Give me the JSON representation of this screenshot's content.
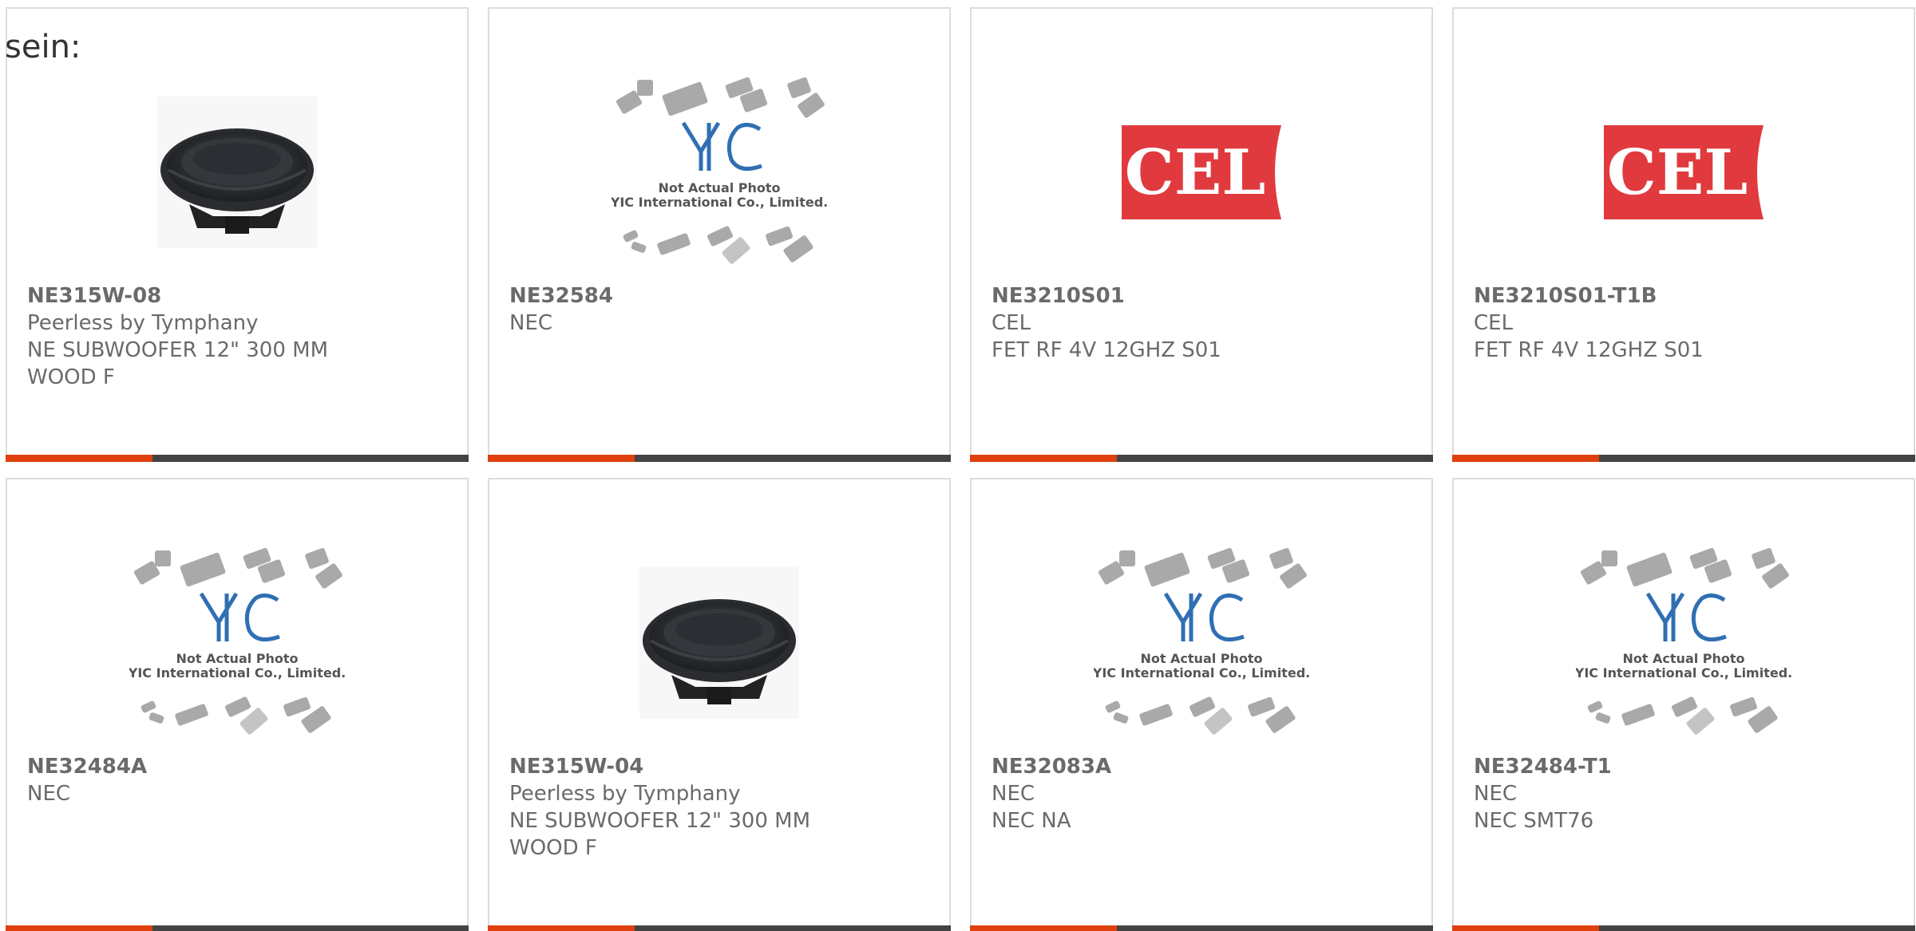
{
  "intro_text": "sein:",
  "products": [
    {
      "part_number": "NE315W-08",
      "manufacturer": "Peerless by Tymphany",
      "description_lines": [
        "NE SUBWOOFER 12\" 300 MM",
        "WOOD F"
      ],
      "image": "speaker"
    },
    {
      "part_number": "NE32584",
      "manufacturer": "NEC",
      "description_lines": [],
      "image": "yic-placeholder"
    },
    {
      "part_number": "NE3210S01",
      "manufacturer": "CEL",
      "description_lines": [
        "FET RF 4V 12GHZ S01"
      ],
      "image": "cel-logo"
    },
    {
      "part_number": "NE3210S01-T1B",
      "manufacturer": "CEL",
      "description_lines": [
        "FET RF 4V 12GHZ S01"
      ],
      "image": "cel-logo"
    },
    {
      "part_number": "NE32484A",
      "manufacturer": "NEC",
      "description_lines": [],
      "image": "yic-placeholder"
    },
    {
      "part_number": "NE315W-04",
      "manufacturer": "Peerless by Tymphany",
      "description_lines": [
        "NE SUBWOOFER 12\" 300 MM",
        "WOOD F"
      ],
      "image": "speaker"
    },
    {
      "part_number": "NE32083A",
      "manufacturer": "NEC",
      "description_lines": [
        "NEC NA"
      ],
      "image": "yic-placeholder"
    },
    {
      "part_number": "NE32484-T1",
      "manufacturer": "NEC",
      "description_lines": [
        "NEC SMT76"
      ],
      "image": "yic-placeholder"
    }
  ],
  "placeholder": {
    "brand_mark": "YIC",
    "caption_line1": "Not Actual Photo",
    "caption_line2": "YIC International Co., Limited."
  },
  "cel_logo_text": "CEL",
  "colors": {
    "accent_bar": "#e0400e",
    "bar": "#434343",
    "cel_red": "#e03a3e",
    "yic_blue": "#2f6fb2"
  }
}
